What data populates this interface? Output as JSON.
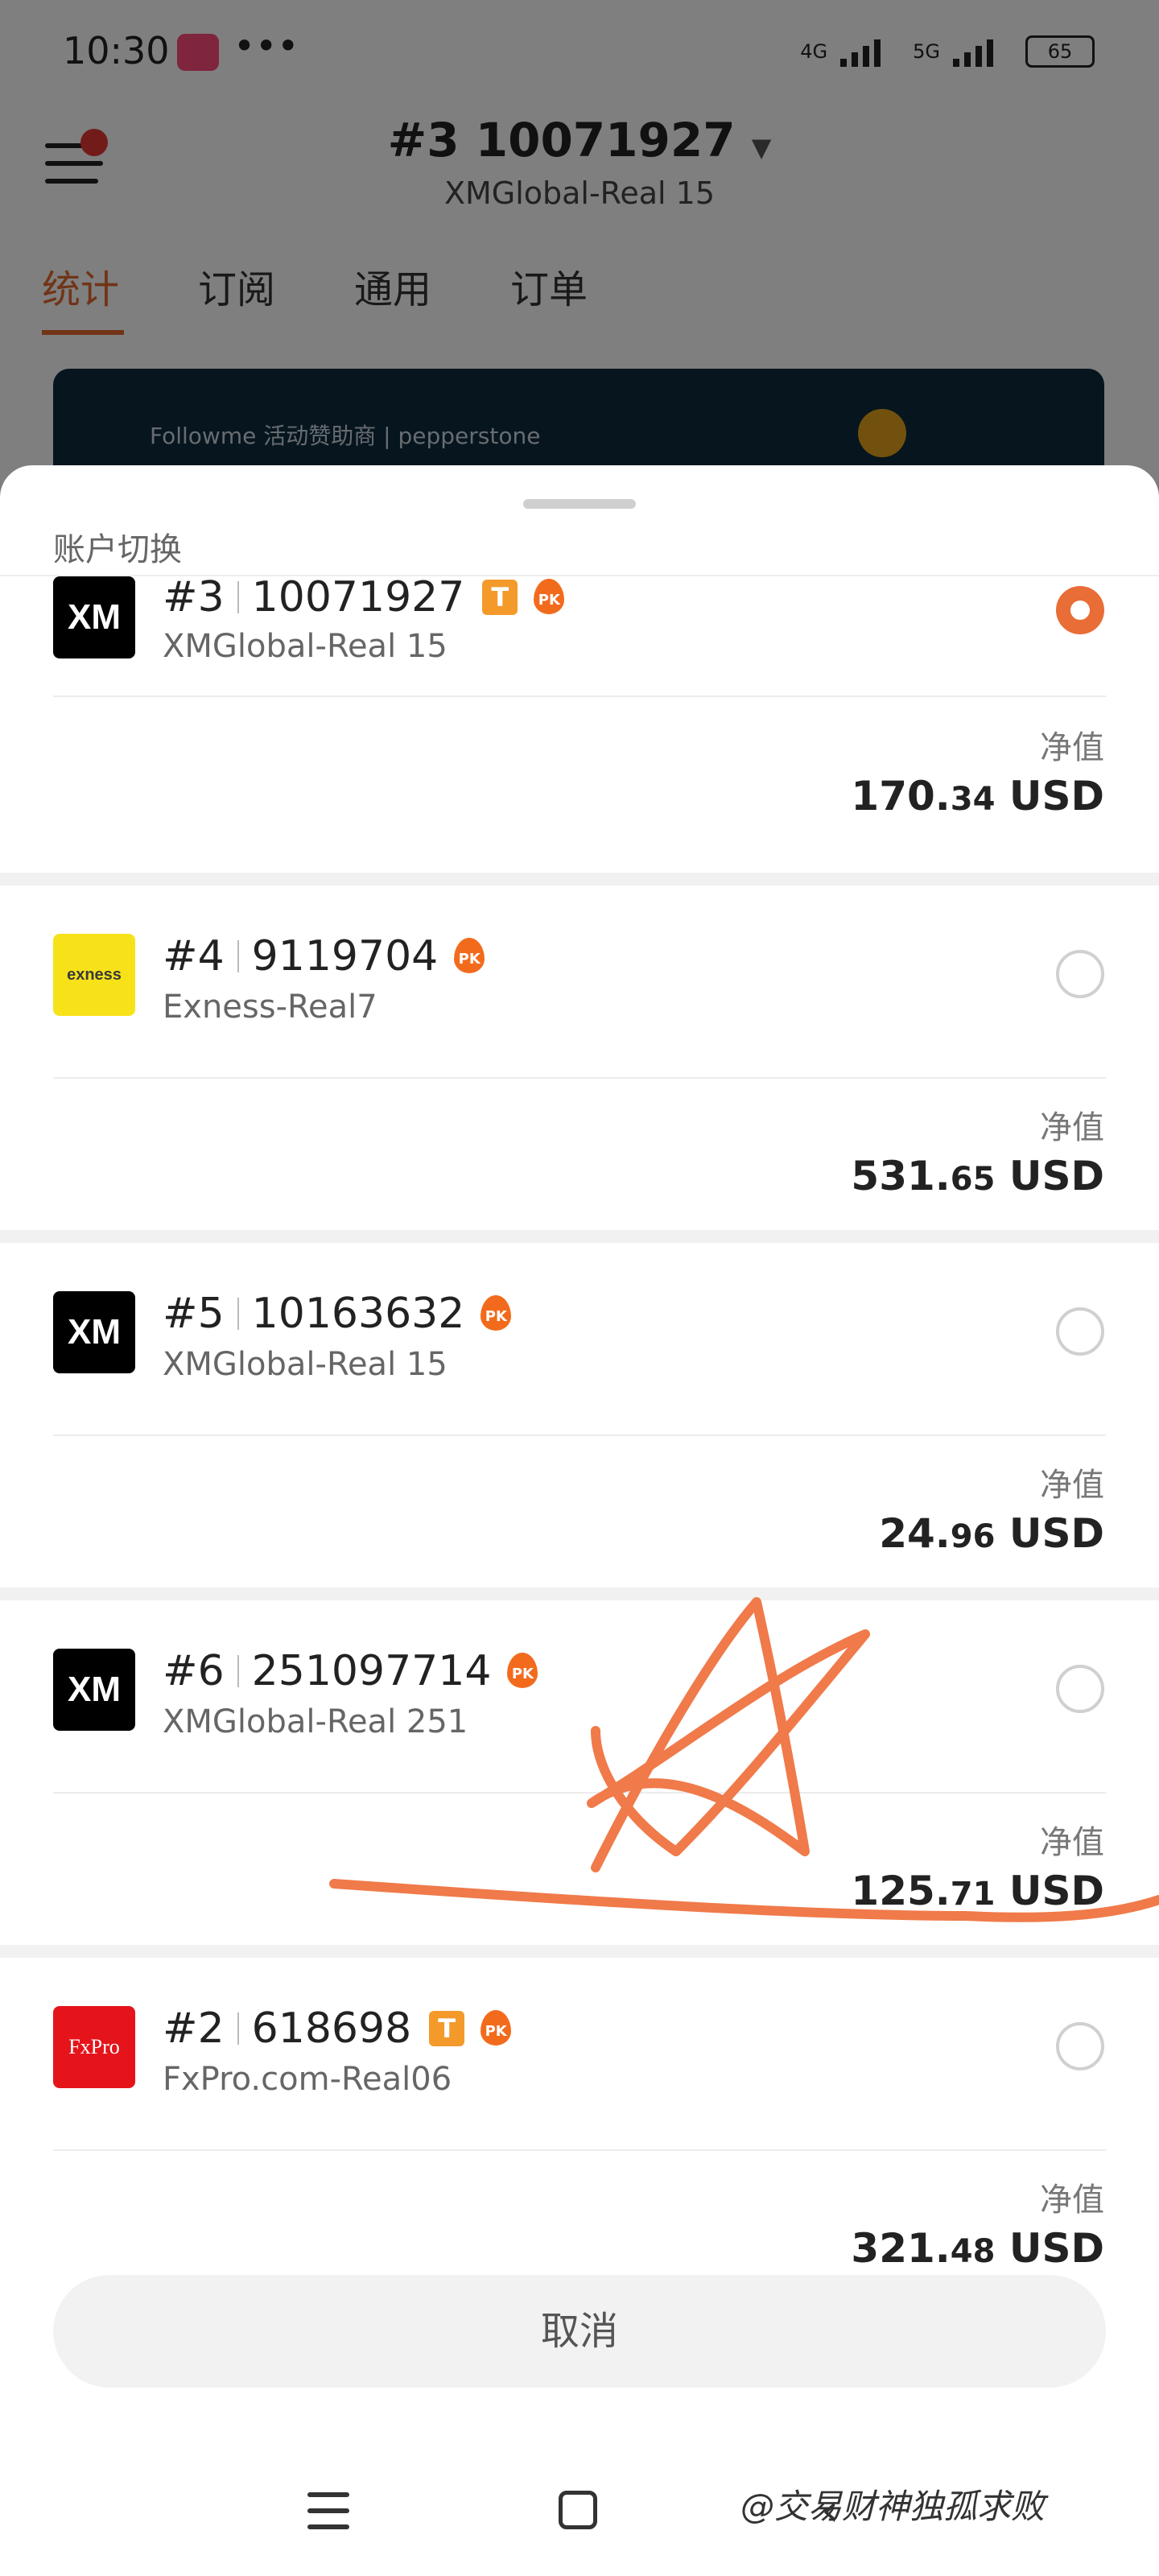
{
  "status": {
    "time": "10:30",
    "dots": "•••",
    "net1": "4G",
    "net2": "5G",
    "battery": "65"
  },
  "header": {
    "account_title": "#3  10071927",
    "server": "XMGlobal-Real 15"
  },
  "tabs": [
    "统计",
    "订阅",
    "通用",
    "订单"
  ],
  "banner": {
    "text": "Followme 活动赞助商  |  pepperstone"
  },
  "sheet": {
    "title": "账户切换",
    "accounts": [
      {
        "num": "#3",
        "id": "10071927",
        "server": "XMGlobal-Real 15",
        "broker_logo": "XM",
        "t_badge": "T",
        "pk": "PK",
        "nv_label": "净值",
        "nv_int": "170.",
        "nv_dec": "34",
        "nv_cur": " USD",
        "selected": true
      },
      {
        "num": "#4",
        "id": "9119704",
        "server": "Exness-Real7",
        "broker_logo": "exness",
        "t_badge": "",
        "pk": "PK",
        "nv_label": "净值",
        "nv_int": "531.",
        "nv_dec": "65",
        "nv_cur": " USD",
        "selected": false
      },
      {
        "num": "#5",
        "id": "10163632",
        "server": "XMGlobal-Real 15",
        "broker_logo": "XM",
        "t_badge": "",
        "pk": "PK",
        "nv_label": "净值",
        "nv_int": "24.",
        "nv_dec": "96",
        "nv_cur": " USD",
        "selected": false
      },
      {
        "num": "#6",
        "id": "251097714",
        "server": "XMGlobal-Real 251",
        "broker_logo": "XM",
        "t_badge": "",
        "pk": "PK",
        "nv_label": "净值",
        "nv_int": "125.",
        "nv_dec": "71",
        "nv_cur": " USD",
        "selected": false
      },
      {
        "num": "#2",
        "id": "618698",
        "server": "FxPro.com-Real06",
        "broker_logo": "FxPro",
        "t_badge": "T",
        "pk": "PK",
        "nv_label": "净值",
        "nv_int": "321.",
        "nv_dec": "48",
        "nv_cur": " USD",
        "selected": false
      }
    ],
    "cancel_label": "取消"
  },
  "watermark": "@交易财神独孤求败",
  "colors": {
    "accent": "#e86d36",
    "scribble": "#f07a4a",
    "badge": "#f39a2b"
  }
}
